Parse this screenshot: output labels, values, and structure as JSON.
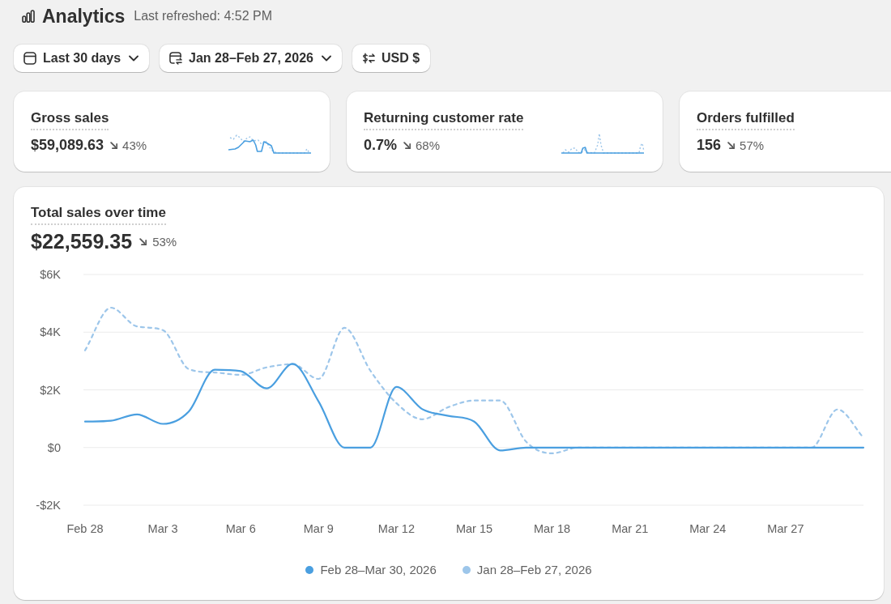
{
  "header": {
    "title": "Analytics",
    "subtitle": "Last refreshed: 4:52 PM"
  },
  "filters": [
    {
      "kind": "period",
      "label": "Last 30 days",
      "dropdown": true
    },
    {
      "kind": "comparison",
      "label": "Jan 28–Feb 27, 2026",
      "dropdown": true
    },
    {
      "kind": "currency",
      "label": "USD $",
      "dropdown": false
    }
  ],
  "metrics": [
    {
      "title": "Gross sales",
      "value": "$59,089.63",
      "change": "43%"
    },
    {
      "title": "Returning customer rate",
      "value": "0.7%",
      "change": "68%"
    },
    {
      "title": "Orders fulfilled",
      "value": "156",
      "change": "57%"
    }
  ],
  "sales_chart": {
    "value": "$22,559.35",
    "change": "53%",
    "chart_data": {
      "type": "line",
      "title": "Total sales over time",
      "grid": true,
      "categories": [
        "Feb 28",
        null,
        null,
        "Mar 3",
        null,
        null,
        "Mar 6",
        null,
        null,
        "Mar 9",
        null,
        null,
        "Mar 12",
        null,
        null,
        "Mar 15",
        null,
        null,
        "Mar 18",
        null,
        null,
        "Mar 21",
        null,
        null,
        "Mar 24",
        null,
        null,
        "Mar 27",
        null,
        null,
        null
      ],
      "ylim": [
        -2000,
        6000
      ],
      "yticks": [
        {
          "value": 6000,
          "label": "$6K"
        },
        {
          "value": 4000,
          "label": "$4K"
        },
        {
          "value": 2000,
          "label": "$2K"
        },
        {
          "value": 0,
          "label": "$0"
        },
        {
          "value": -2000,
          "label": "-$2K"
        }
      ],
      "series": [
        {
          "name": "Feb 28–Mar 30, 2026",
          "color": "#4a9fe0",
          "line_style": "solid",
          "values": [
            900,
            930,
            1150,
            820,
            1250,
            2700,
            2650,
            2050,
            2900,
            1600,
            0,
            0,
            2100,
            1330,
            1100,
            900,
            -100,
            0,
            0,
            0,
            0,
            0,
            0,
            0,
            0,
            0,
            0,
            0,
            0,
            0,
            0
          ]
        },
        {
          "name": "Jan 28–Feb 27, 2026",
          "color": "#9dc6ea",
          "line_style": "dashed",
          "values": [
            3370,
            4850,
            4200,
            4070,
            2720,
            2600,
            2520,
            2780,
            2890,
            2380,
            4150,
            2660,
            1540,
            980,
            1400,
            1630,
            1630,
            200,
            -200,
            0,
            0,
            0,
            0,
            0,
            0,
            0,
            0,
            0,
            0,
            1320,
            340
          ]
        }
      ]
    }
  }
}
